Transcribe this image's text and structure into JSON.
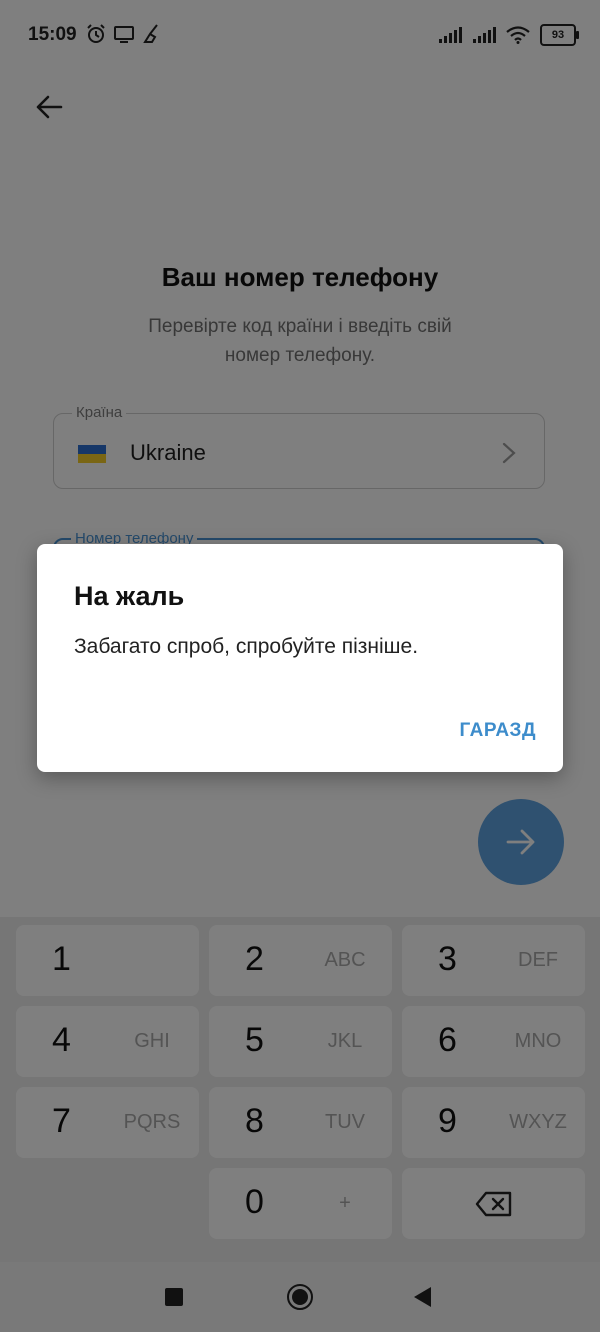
{
  "status_bar": {
    "time": "15:09",
    "battery": "93",
    "icons_left": [
      "alarm-icon",
      "screen-cast-icon",
      "cleaner-icon"
    ],
    "icons_right": [
      "signal-icon",
      "signal-icon",
      "wifi-icon",
      "battery-icon"
    ]
  },
  "header": {
    "back_icon": "arrow-left-icon"
  },
  "page": {
    "title": "Ваш номер телефону",
    "subtitle": "Перевірте код країни і введіть свій номер телефону."
  },
  "country_field": {
    "label": "Країна",
    "value": "Ukraine",
    "flag": "ukraine-flag",
    "colors": {
      "flag_blue": "#2d6fd1",
      "flag_yellow": "#f4cc28"
    }
  },
  "phone_field": {
    "label": "Номер телефону",
    "accent_color": "#4a95d6"
  },
  "next_button": {
    "icon": "arrow-right-icon",
    "color": "#5ea3e0"
  },
  "keypad": {
    "keys": [
      {
        "digit": "1",
        "letters": ""
      },
      {
        "digit": "2",
        "letters": "ABC"
      },
      {
        "digit": "3",
        "letters": "DEF"
      },
      {
        "digit": "4",
        "letters": "GHI"
      },
      {
        "digit": "5",
        "letters": "JKL"
      },
      {
        "digit": "6",
        "letters": "MNO"
      },
      {
        "digit": "7",
        "letters": "PQRS"
      },
      {
        "digit": "8",
        "letters": "TUV"
      },
      {
        "digit": "9",
        "letters": "WXYZ"
      },
      {
        "digit": "0",
        "letters": "+"
      }
    ],
    "backspace_icon": "backspace-icon"
  },
  "dialog": {
    "title": "На жаль",
    "message": "Забагато спроб, спробуйте пізніше.",
    "ok_label": "ГАРАЗД",
    "accent_color": "#3d8ccb"
  },
  "nav_bar": {
    "icons": [
      "recents-icon",
      "home-icon",
      "back-icon"
    ]
  }
}
